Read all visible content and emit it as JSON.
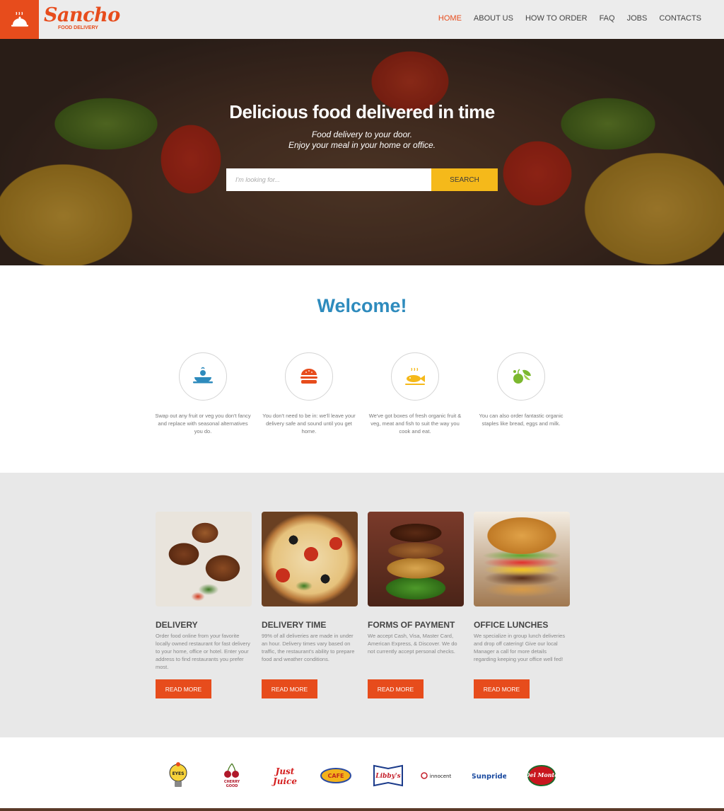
{
  "header": {
    "brand_name": "Sancho",
    "brand_sub": "FOOD DELIVERY",
    "nav": [
      {
        "label": "HOME",
        "active": true
      },
      {
        "label": "ABOUT US",
        "active": false
      },
      {
        "label": "HOW TO ORDER",
        "active": false
      },
      {
        "label": "FAQ",
        "active": false
      },
      {
        "label": "JOBS",
        "active": false
      },
      {
        "label": "CONTACTS",
        "active": false
      }
    ]
  },
  "hero": {
    "title": "Delicious food delivered in time",
    "subtitle_line1": "Food delivery to your door.",
    "subtitle_line2": "Enjoy your meal in your home or office.",
    "search_placeholder": "I'm looking for...",
    "search_button": "SEARCH"
  },
  "welcome": {
    "title": "Welcome!",
    "features": [
      {
        "icon": "dish-icon",
        "text": "Swap out any fruit or veg you don't fancy and replace with seasonal alternatives you do."
      },
      {
        "icon": "burger-icon",
        "text": "You don't need to be in: we'll leave your delivery safe and sound until you get home."
      },
      {
        "icon": "fish-icon",
        "text": "We've got boxes of fresh organic fruit & veg, meat and fish to suit the way you cook and eat."
      },
      {
        "icon": "fruit-icon",
        "text": "You can also order fantastic organic staples like bread, eggs and milk."
      }
    ]
  },
  "services": [
    {
      "title": "DELIVERY",
      "text": "Order food online from your favorite locally owned restaurant for fast delivery to your home, office or hotel. Enter your address to find restaurants you prefer most.",
      "button": "READ MORE"
    },
    {
      "title": "DELIVERY TIME",
      "text": "99% of all deliveries are made in under an hour. Delivery times vary based on traffic, the restaurant's ability to prepare food and weather conditions.",
      "button": "READ MORE"
    },
    {
      "title": "FORMS OF PAYMENT",
      "text": "We accept Cash, Visa, Master Card, American Express, & Discover. We do not currently accept personal checks.",
      "button": "READ MORE"
    },
    {
      "title": "OFFICE LUNCHES",
      "text": "We specialize in group lunch deliveries and drop off catering! Give our local Manager a call for more details regarding keeping your office well fed!",
      "button": "READ MORE"
    }
  ],
  "partners": [
    {
      "name": "Eyes Vision"
    },
    {
      "name": "Cherry Good"
    },
    {
      "name": "Just Juice"
    },
    {
      "name": "Cafe Town"
    },
    {
      "name": "Libby's"
    },
    {
      "name": "innocent"
    },
    {
      "name": "Sunpride"
    },
    {
      "name": "Del Monte"
    }
  ],
  "colors": {
    "accent": "#e74c1c",
    "search_button": "#f5b91a",
    "welcome_title": "#2e8bbd",
    "services_bg": "#e8e8e8",
    "header_bg": "#ececec"
  }
}
